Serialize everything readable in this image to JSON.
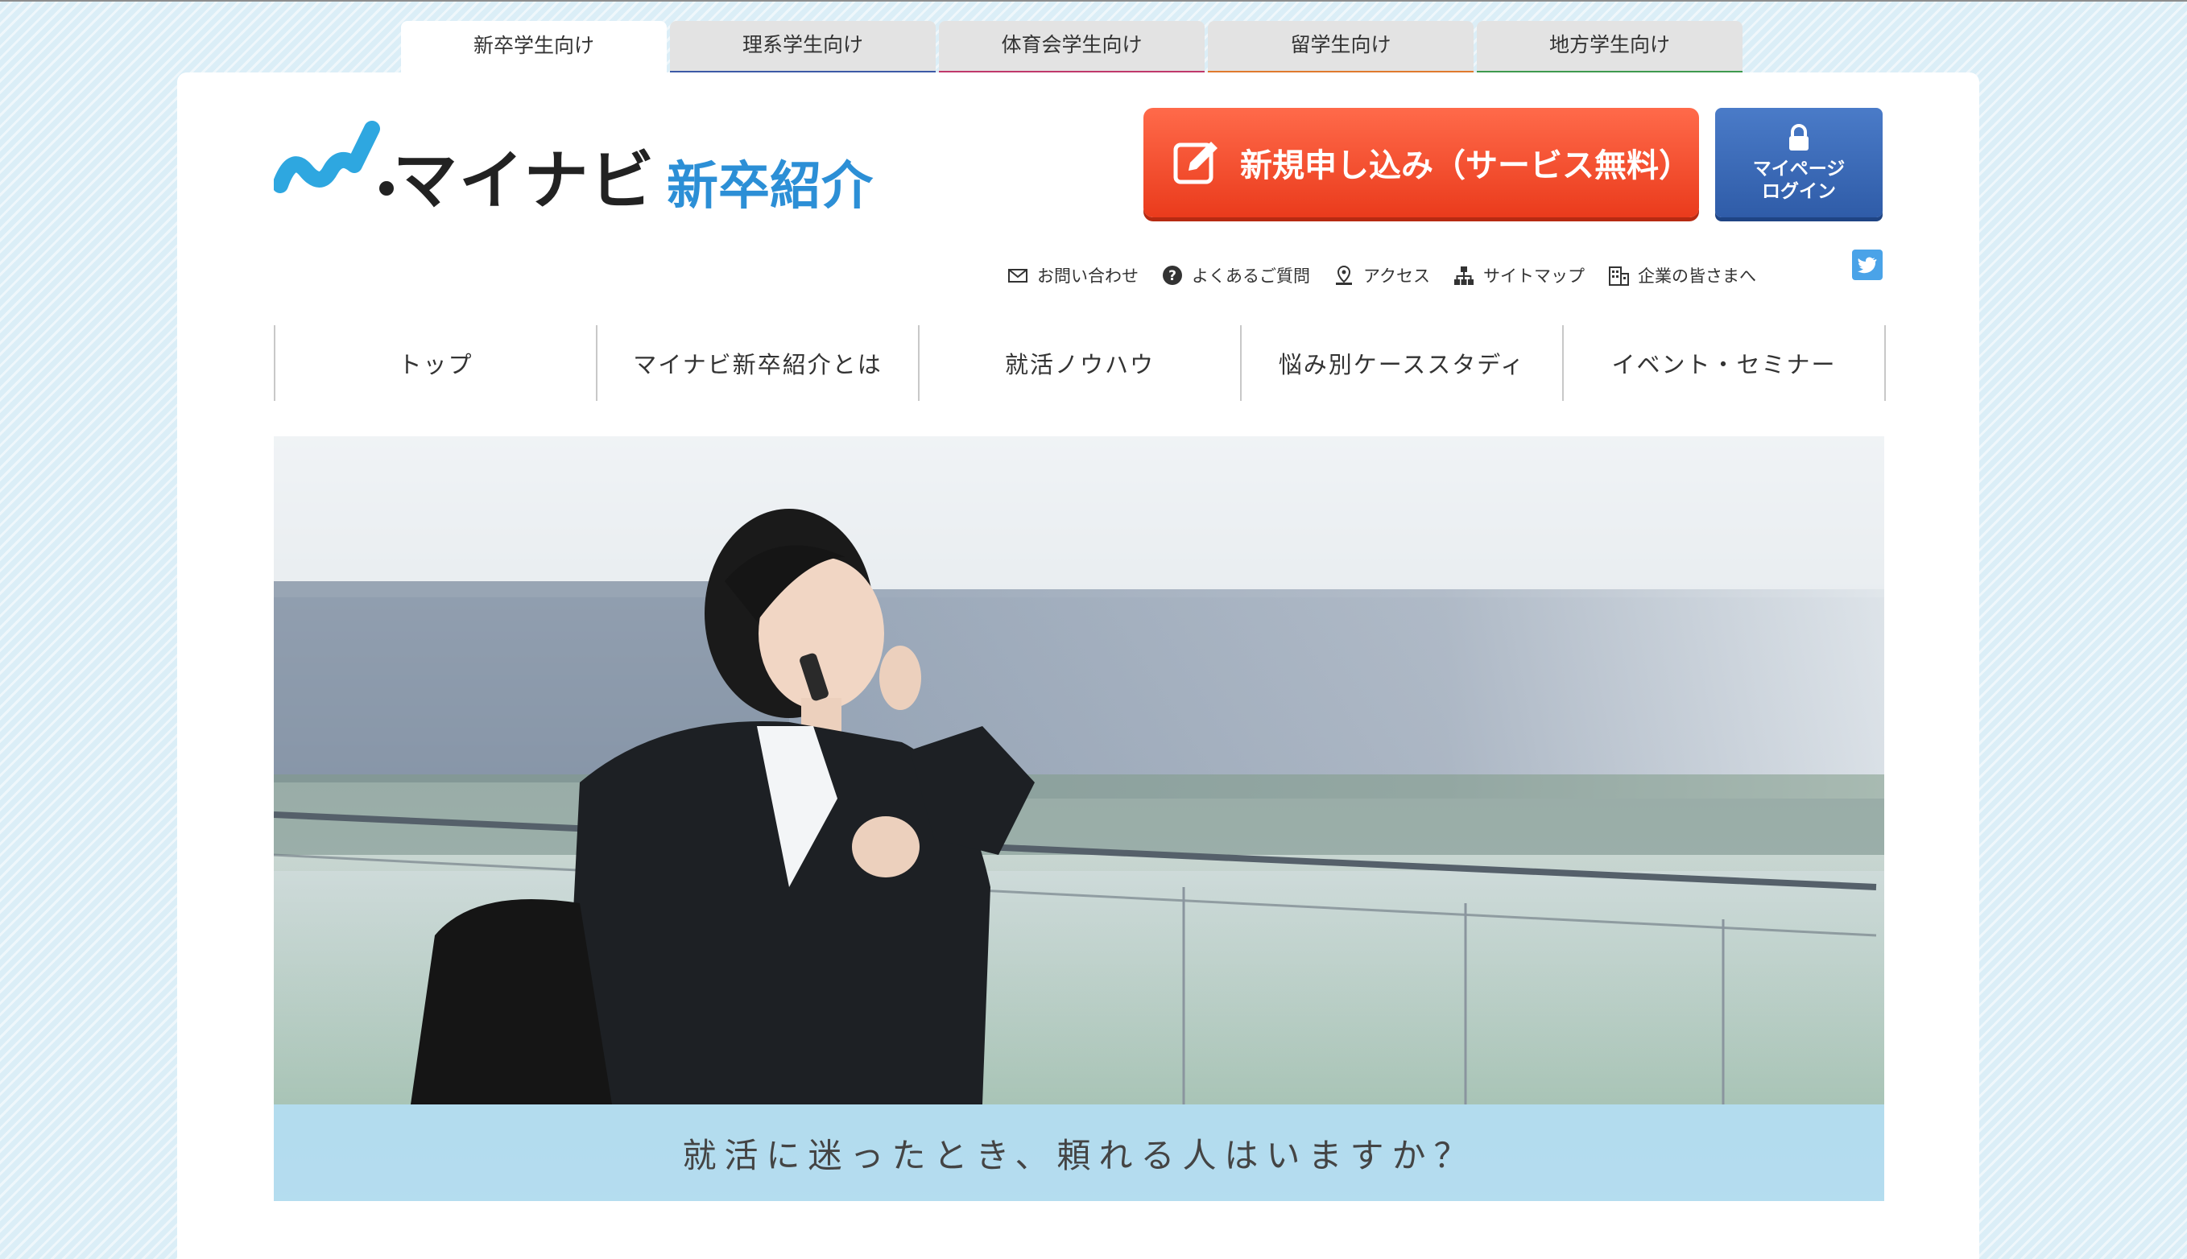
{
  "audience_tabs": [
    {
      "label": "新卒学生向け",
      "color": "#3b9fe0",
      "active": true
    },
    {
      "label": "理系学生向け",
      "color": "#3c5aa6",
      "active": false
    },
    {
      "label": "体育会学生向け",
      "color": "#c0396b",
      "active": false
    },
    {
      "label": "留学生向け",
      "color": "#e07a2e",
      "active": false
    },
    {
      "label": "地方学生向け",
      "color": "#3e9a4f",
      "active": false
    }
  ],
  "logo": {
    "brand": "マイナビ",
    "sub": "新卒紹介"
  },
  "cta": {
    "label": "新規申し込み（サービス無料）",
    "icon": "edit-icon"
  },
  "mypage": {
    "line1": "マイページ",
    "line2": "ログイン",
    "icon": "lock-icon"
  },
  "utility_links": [
    {
      "label": "お問い合わせ",
      "icon": "mail-icon"
    },
    {
      "label": "よくあるご質問",
      "icon": "question-icon"
    },
    {
      "label": "アクセス",
      "icon": "location-icon"
    },
    {
      "label": "サイトマップ",
      "icon": "sitemap-icon"
    },
    {
      "label": "企業の皆さまへ",
      "icon": "building-icon"
    }
  ],
  "social": {
    "icon": "twitter-icon"
  },
  "global_nav": [
    {
      "label": "トップ"
    },
    {
      "label": "マイナビ新卒紹介とは"
    },
    {
      "label": "就活ノウハウ"
    },
    {
      "label": "悩み別ケーススタディ"
    },
    {
      "label": "イベント・セミナー"
    }
  ],
  "hero": {
    "caption": "就活に迷ったとき、頼れる人はいますか？"
  },
  "colors": {
    "accent": "#2c8fd6",
    "cta": "#ea3b1c",
    "mypage": "#2f5ca8",
    "background": "#dbeef7"
  }
}
